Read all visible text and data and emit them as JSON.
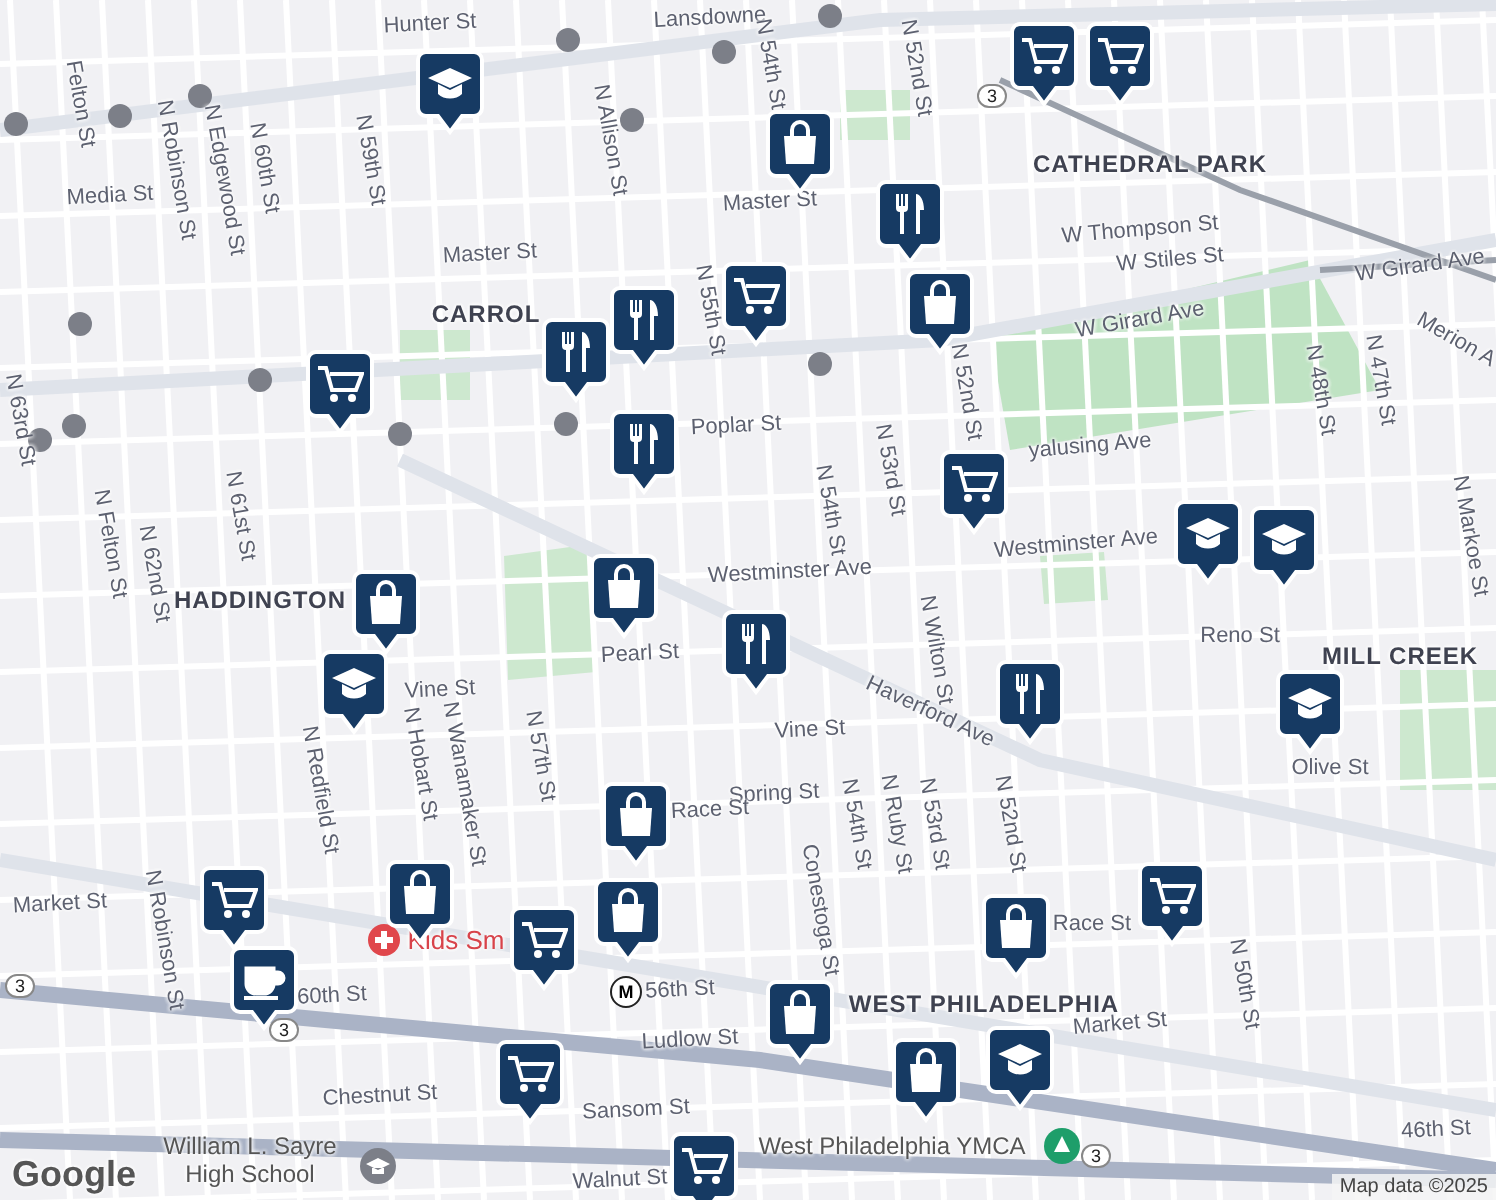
{
  "labels": [
    {
      "text": "Hunter St",
      "kind": "street"
    },
    {
      "text": "Lansdowne",
      "kind": "street"
    },
    {
      "text": "Felton St",
      "kind": "street"
    },
    {
      "text": "N Robinson St",
      "kind": "street"
    },
    {
      "text": "N Edgewood St",
      "kind": "street"
    },
    {
      "text": "N 60th St",
      "kind": "street"
    },
    {
      "text": "N 59th St",
      "kind": "street"
    },
    {
      "text": "N Allison St",
      "kind": "street"
    },
    {
      "text": "N 54th St",
      "kind": "street"
    },
    {
      "text": "N 52nd St",
      "kind": "street"
    },
    {
      "text": "Media St",
      "kind": "street"
    },
    {
      "text": "CATHEDRAL PARK",
      "kind": "area"
    },
    {
      "text": "Master St",
      "kind": "street"
    },
    {
      "text": "Master St",
      "kind": "street"
    },
    {
      "text": "W Thompson St",
      "kind": "street"
    },
    {
      "text": "W Stiles St",
      "kind": "street"
    },
    {
      "text": "W Girard Ave",
      "kind": "street"
    },
    {
      "text": "W Girard Ave",
      "kind": "street"
    },
    {
      "text": "Merion A",
      "kind": "street"
    },
    {
      "text": "CARROL",
      "kind": "area"
    },
    {
      "text": "N 55th St",
      "kind": "street"
    },
    {
      "text": "Poplar St",
      "kind": "street"
    },
    {
      "text": "yalusing Ave",
      "kind": "street"
    },
    {
      "text": "Westminster Ave",
      "kind": "street"
    },
    {
      "text": "Westminster Ave",
      "kind": "street"
    },
    {
      "text": "N 54th St",
      "kind": "street"
    },
    {
      "text": "N 53rd St",
      "kind": "street"
    },
    {
      "text": "N 52nd St",
      "kind": "street"
    },
    {
      "text": "N 48th St",
      "kind": "street"
    },
    {
      "text": "N 47th St",
      "kind": "street"
    },
    {
      "text": "N 63rd St",
      "kind": "street"
    },
    {
      "text": "N Felton St",
      "kind": "street"
    },
    {
      "text": "N 62nd St",
      "kind": "street"
    },
    {
      "text": "N 61st St",
      "kind": "street"
    },
    {
      "text": "N Redfield St",
      "kind": "street"
    },
    {
      "text": "HADDINGTON",
      "kind": "area"
    },
    {
      "text": "Pearl St",
      "kind": "street"
    },
    {
      "text": "Vine St",
      "kind": "street"
    },
    {
      "text": "Vine St",
      "kind": "street"
    },
    {
      "text": "Haverford Ave",
      "kind": "street"
    },
    {
      "text": "N Wilton St",
      "kind": "street"
    },
    {
      "text": "Reno St",
      "kind": "street"
    },
    {
      "text": "MILL CREEK",
      "kind": "area"
    },
    {
      "text": "N Markoe St",
      "kind": "street"
    },
    {
      "text": "Olive St",
      "kind": "street"
    },
    {
      "text": "N Hobart St",
      "kind": "street"
    },
    {
      "text": "N Wanamaker St",
      "kind": "street"
    },
    {
      "text": "N 57th St",
      "kind": "street"
    },
    {
      "text": "Spring St",
      "kind": "street"
    },
    {
      "text": "Race St",
      "kind": "street"
    },
    {
      "text": "Race St",
      "kind": "street"
    },
    {
      "text": "N 54th St",
      "kind": "street"
    },
    {
      "text": "N Ruby St",
      "kind": "street"
    },
    {
      "text": "N 53rd St",
      "kind": "street"
    },
    {
      "text": "N 52nd St",
      "kind": "street"
    },
    {
      "text": "N 50th St",
      "kind": "street"
    },
    {
      "text": "N Robinson St",
      "kind": "street"
    },
    {
      "text": "Market St",
      "kind": "street"
    },
    {
      "text": "Market St",
      "kind": "street"
    },
    {
      "text": "60th St",
      "kind": "street"
    },
    {
      "text": "56th St",
      "kind": "street"
    },
    {
      "text": "Conestoga St",
      "kind": "street"
    },
    {
      "text": "WEST PHILADELPHIA",
      "kind": "area"
    },
    {
      "text": "Ludlow St",
      "kind": "street"
    },
    {
      "text": "Chestnut St",
      "kind": "street"
    },
    {
      "text": "Sansom St",
      "kind": "street"
    },
    {
      "text": "William L. Sayre High School",
      "kind": "poi"
    },
    {
      "text": "Walnut St",
      "kind": "street"
    },
    {
      "text": "West Philadelphia YMCA",
      "kind": "poi"
    },
    {
      "text": "46th St",
      "kind": "street"
    },
    {
      "text": "Kids Sm",
      "kind": "hospital"
    }
  ],
  "pins": [
    {
      "kind": "cart"
    },
    {
      "kind": "cart"
    },
    {
      "kind": "school"
    },
    {
      "kind": "bag"
    },
    {
      "kind": "food"
    },
    {
      "kind": "bag"
    },
    {
      "kind": "cart"
    },
    {
      "kind": "food"
    },
    {
      "kind": "food"
    },
    {
      "kind": "cart"
    },
    {
      "kind": "food"
    },
    {
      "kind": "cart"
    },
    {
      "kind": "school"
    },
    {
      "kind": "school"
    },
    {
      "kind": "bag"
    },
    {
      "kind": "bag"
    },
    {
      "kind": "food"
    },
    {
      "kind": "school"
    },
    {
      "kind": "food"
    },
    {
      "kind": "school"
    },
    {
      "kind": "bag"
    },
    {
      "kind": "bag"
    },
    {
      "kind": "bag"
    },
    {
      "kind": "cart"
    },
    {
      "kind": "cart"
    },
    {
      "kind": "coffee"
    },
    {
      "kind": "bag"
    },
    {
      "kind": "bag"
    },
    {
      "kind": "cart"
    },
    {
      "kind": "bag"
    },
    {
      "kind": "school"
    },
    {
      "kind": "cart"
    },
    {
      "kind": "cart"
    }
  ],
  "route_shields": [
    "3",
    "3",
    "3",
    "3"
  ],
  "metro_badge": "M",
  "logo": "Google",
  "attribution": "Map data ©2025"
}
